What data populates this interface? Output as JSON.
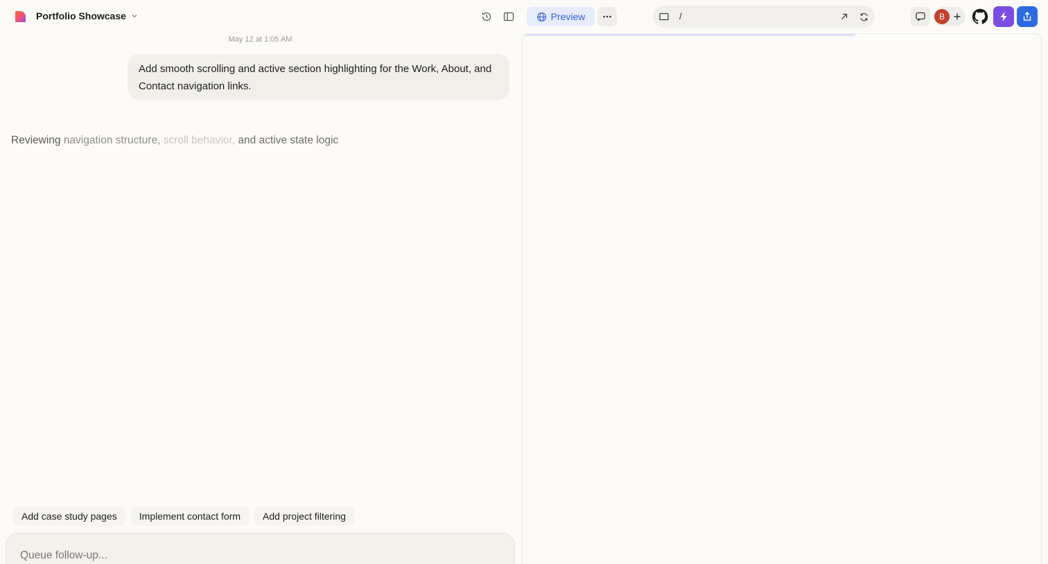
{
  "header": {
    "project_title": "Portfolio Showcase",
    "preview_label": "Preview",
    "url_path": "/",
    "avatar_initial": "B",
    "icons": {
      "logo": "app-logo",
      "project_menu": "chevron-down-icon",
      "history": "history-icon",
      "sidebar": "sidebar-toggle-icon",
      "preview": "globe-icon",
      "more": "more-horizontal-icon",
      "device": "laptop-icon",
      "open_external": "arrow-up-right-icon",
      "reload": "refresh-icon",
      "chat": "chat-bubble-icon",
      "invite": "plus-icon",
      "github": "github-icon",
      "upgrade": "lightning-icon",
      "publish": "share-upload-icon"
    },
    "colors": {
      "preview_accent": "#2f5fd8",
      "upgrade": "#7b4de0",
      "publish": "#2d6be4",
      "avatar": "#c2412b"
    }
  },
  "chat": {
    "timestamp": "May 12 at 1:05 AM",
    "user_message": "Add smooth scrolling and active section highlighting for the Work, About, and Contact navigation links.",
    "status": {
      "part1": "Reviewing ",
      "part2": "navigation structure, ",
      "part3": "scroll behavior, ",
      "part4": "and active state logic"
    },
    "suggestions": [
      "Add case study pages",
      "Implement contact form",
      "Add project filtering"
    ],
    "composer_placeholder": "Queue follow-up..."
  },
  "preview": {
    "loading_progress": 0.64
  }
}
